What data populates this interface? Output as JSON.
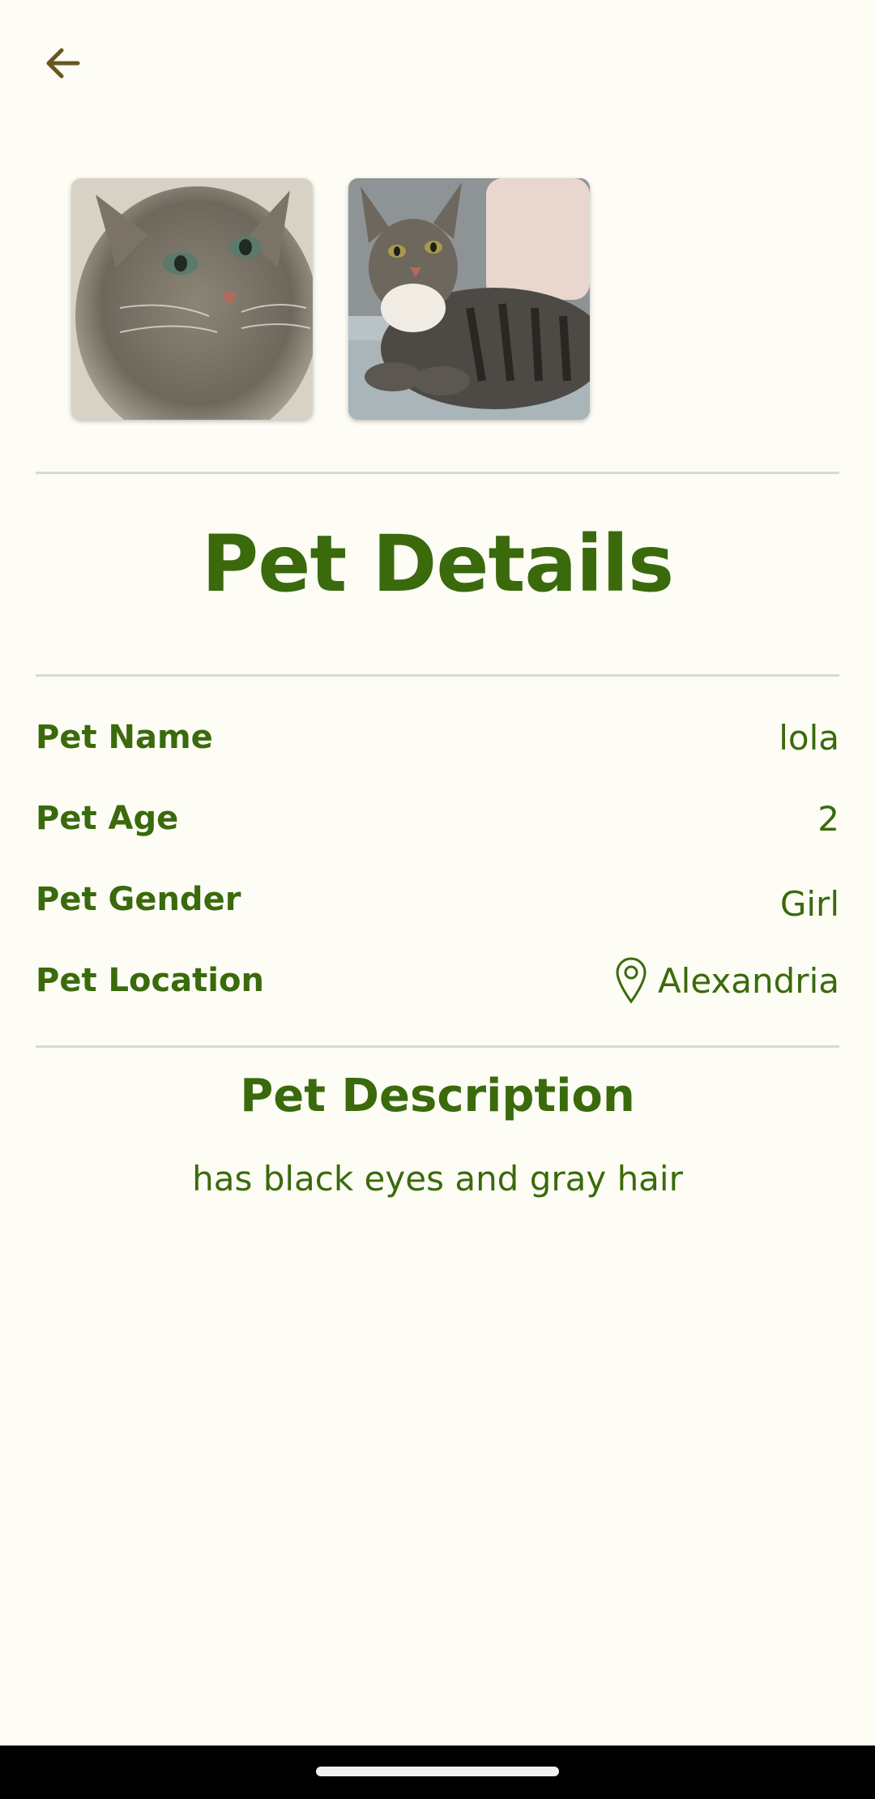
{
  "header": {
    "back_icon": "arrow-left-icon"
  },
  "photos": [
    {
      "alt": "cat-photo-1"
    },
    {
      "alt": "cat-photo-2"
    }
  ],
  "details": {
    "title": "Pet Details",
    "rows": [
      {
        "label": "Pet Name",
        "value": "lola"
      },
      {
        "label": "Pet Age",
        "value": "2"
      },
      {
        "label": "Pet Gender",
        "value": "Girl"
      },
      {
        "label": "Pet Location",
        "value": "Alexandria",
        "icon": "location-pin-icon"
      }
    ]
  },
  "description": {
    "title": "Pet Description",
    "text": "has black eyes and gray hair"
  },
  "colors": {
    "primary": "#3a6a0c",
    "background": "#fdfdf5",
    "back_icon": "#6b5420",
    "divider": "#d9d9d6"
  }
}
